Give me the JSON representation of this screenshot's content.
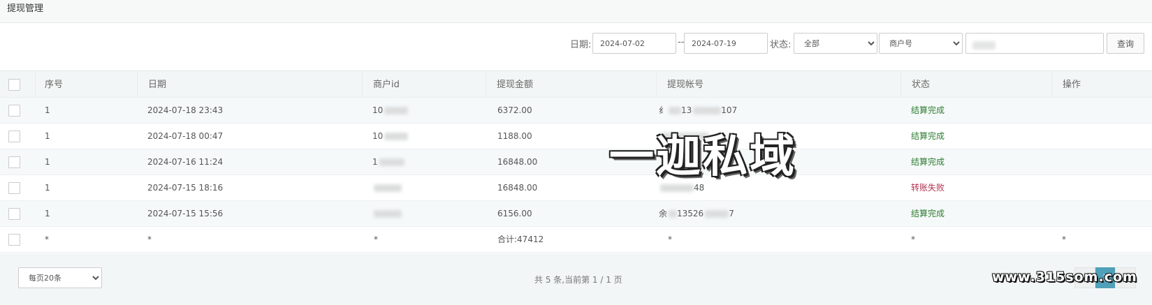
{
  "page": {
    "title": "提现管理"
  },
  "filters": {
    "date_label": "日期:",
    "date_from": "2024-07-02",
    "date_sep": "--",
    "date_to": "2024-07-19",
    "status_label": "状态:",
    "status_value": "全部",
    "field_value": "商户号",
    "keyword_value": "",
    "search_button": "查询"
  },
  "table": {
    "headers": [
      "序号",
      "日期",
      "商户id",
      "提现金额",
      "提现帐号",
      "状态",
      "操作"
    ],
    "rows": [
      {
        "no": "1",
        "date": "2024-07-18 23:43",
        "merchant": "10",
        "amount": "6372.00",
        "account_start": "纟",
        "account_mid": "13",
        "account_end": "107",
        "status": "结算完成",
        "status_type": "ok"
      },
      {
        "no": "1",
        "date": "2024-07-18 00:47",
        "merchant": "10",
        "amount": "1188.00",
        "account_start": "",
        "account_mid": "",
        "account_end": "",
        "status": "结算完成",
        "status_type": "ok"
      },
      {
        "no": "1",
        "date": "2024-07-16 11:24",
        "merchant": "1",
        "amount": "16848.00",
        "account_start": "",
        "account_mid": "",
        "account_end": "",
        "status": "结算完成",
        "status_type": "ok"
      },
      {
        "no": "1",
        "date": "2024-07-15 18:16",
        "merchant": "",
        "amount": "16848.00",
        "account_start": "",
        "account_mid": "",
        "account_end": "48",
        "status": "转账失败",
        "status_type": "fail"
      },
      {
        "no": "1",
        "date": "2024-07-15 15:56",
        "merchant": "",
        "amount": "6156.00",
        "account_start": "余",
        "account_mid": "13526",
        "account_end": "7",
        "status": "结算完成",
        "status_type": "ok"
      }
    ],
    "total_row": {
      "no": "*",
      "date": "*",
      "merchant": "*",
      "amount": "合计:47412",
      "account": "*",
      "status": "*",
      "action": "*"
    }
  },
  "footer": {
    "page_size": "每页20条",
    "summary": "共 5 条,当前第 1 / 1 页",
    "current_page": "1",
    "prev_label": "‹",
    "next_label": "›"
  },
  "watermark": {
    "text": "一迦私域",
    "site": "www.315som.com"
  },
  "colors": {
    "status_ok": "#2e7d32",
    "status_fail": "#b0324f",
    "pager_active": "#4fa0b8"
  }
}
